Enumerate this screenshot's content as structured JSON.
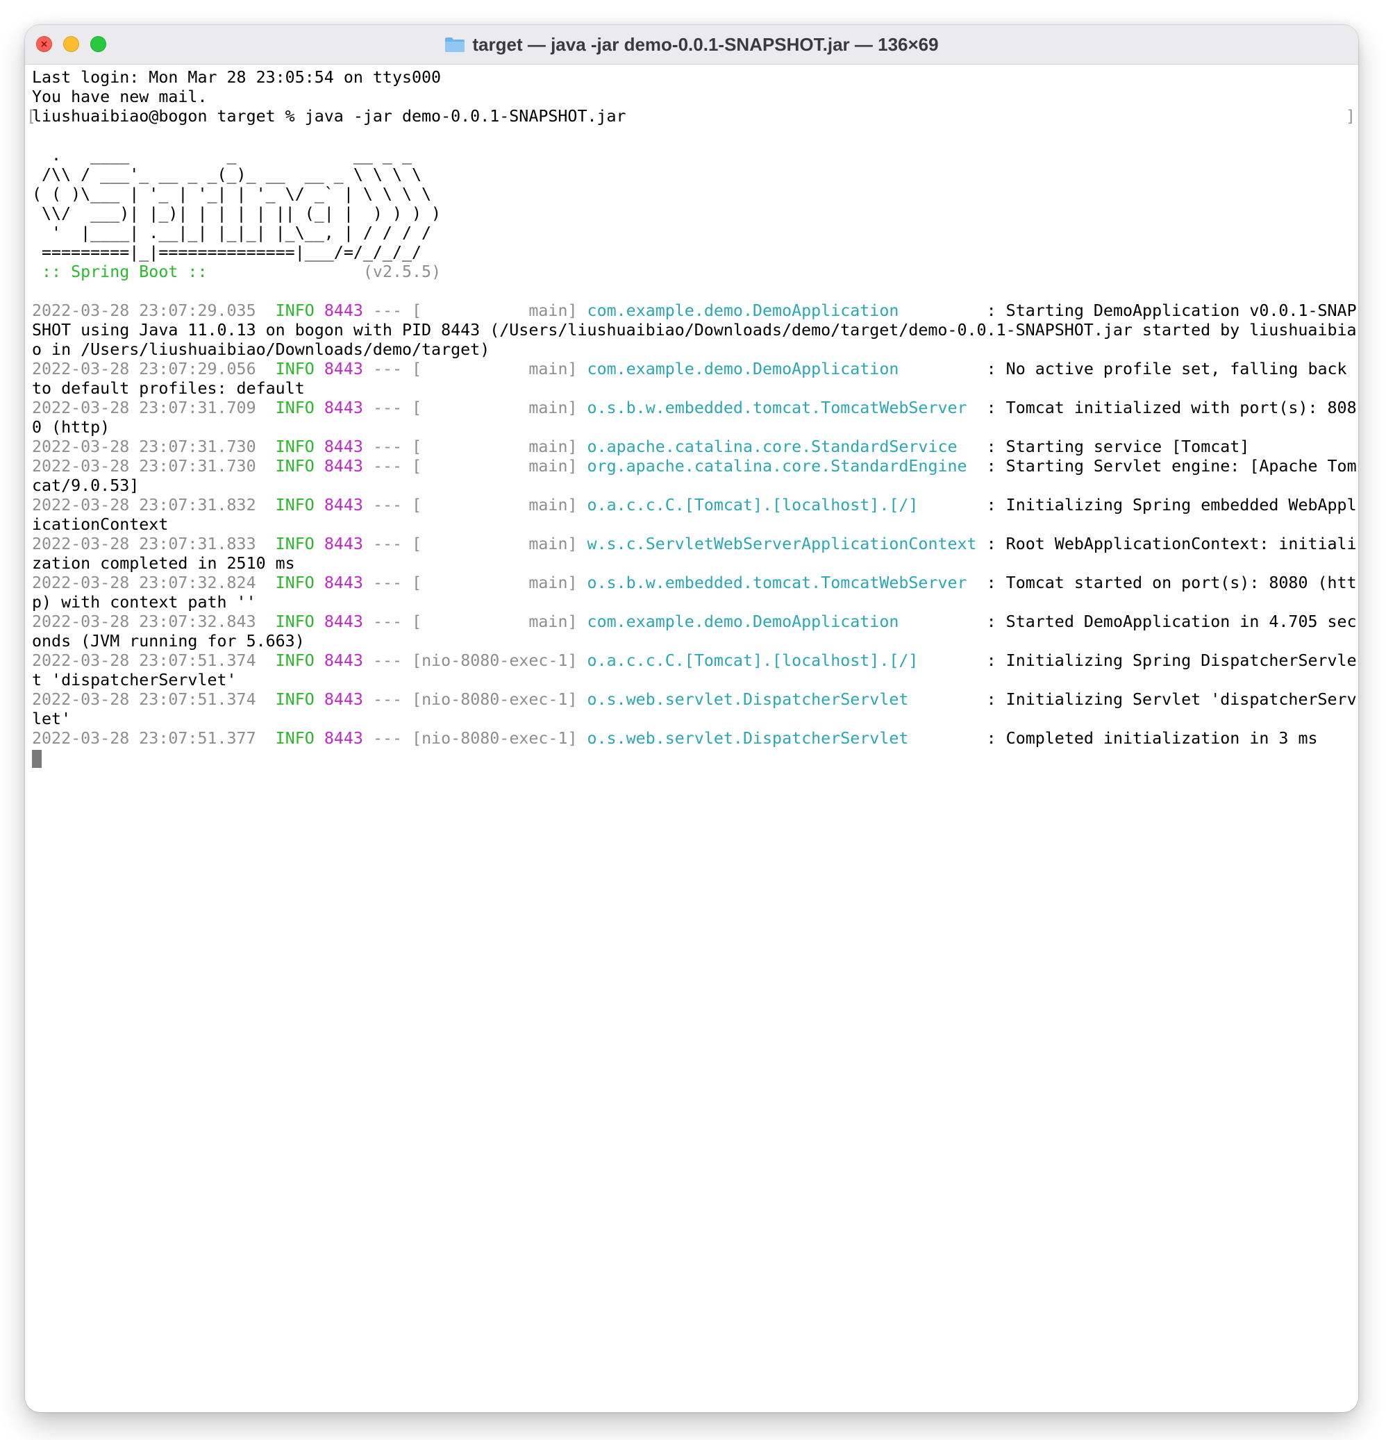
{
  "window": {
    "title": "target — java -jar demo-0.0.1-SNAPSHOT.jar — 136×69",
    "icon": "folder-icon"
  },
  "terminal": {
    "last_login": "Last login: Mon Mar 28 23:05:54 on ttys000",
    "mail": "You have new mail.",
    "prompt": "liushuaibiao@bogon target % java -jar demo-0.0.1-SNAPSHOT.jar",
    "banner": [
      "  .   ____          _            __ _ _",
      " /\\\\ / ___'_ __ _ _(_)_ __  __ _ \\ \\ \\ \\",
      "( ( )\\___ | '_ | '_| | '_ \\/ _` | \\ \\ \\ \\",
      " \\\\/  ___)| |_)| | | | | || (_| |  ) ) ) )",
      "  '  |____| .__|_| |_|_| |_\\__, | / / / /",
      " =========|_|==============|___/=/_/_/_/"
    ],
    "spring_boot_label": " :: Spring Boot :: ",
    "spring_boot_version": "               (v2.5.5)",
    "logs": [
      {
        "ts": "2022-03-28 23:07:29.035",
        "level": "INFO",
        "pid": "8443",
        "sep": "---",
        "thread": "[           main]",
        "logger": "com.example.demo.DemoApplication        ",
        "msg": ": Starting DemoApplication v0.0.1-SNAP",
        "cont": [
          "SHOT using Java 11.0.13 on bogon with PID 8443 (/Users/liushuaibiao/Downloads/demo/target/demo-0.0.1-SNAPSHOT.jar started by liushuaibia",
          "o in /Users/liushuaibiao/Downloads/demo/target)"
        ]
      },
      {
        "ts": "2022-03-28 23:07:29.056",
        "level": "INFO",
        "pid": "8443",
        "sep": "---",
        "thread": "[           main]",
        "logger": "com.example.demo.DemoApplication        ",
        "msg": ": No active profile set, falling back",
        "cont": [
          "to default profiles: default"
        ]
      },
      {
        "ts": "2022-03-28 23:07:31.709",
        "level": "INFO",
        "pid": "8443",
        "sep": "---",
        "thread": "[           main]",
        "logger": "o.s.b.w.embedded.tomcat.TomcatWebServer ",
        "msg": ": Tomcat initialized with port(s): 808",
        "cont": [
          "0 (http)"
        ]
      },
      {
        "ts": "2022-03-28 23:07:31.730",
        "level": "INFO",
        "pid": "8443",
        "sep": "---",
        "thread": "[           main]",
        "logger": "o.apache.catalina.core.StandardService  ",
        "msg": ": Starting service [Tomcat]",
        "cont": []
      },
      {
        "ts": "2022-03-28 23:07:31.730",
        "level": "INFO",
        "pid": "8443",
        "sep": "---",
        "thread": "[           main]",
        "logger": "org.apache.catalina.core.StandardEngine ",
        "msg": ": Starting Servlet engine: [Apache Tom",
        "cont": [
          "cat/9.0.53]"
        ]
      },
      {
        "ts": "2022-03-28 23:07:31.832",
        "level": "INFO",
        "pid": "8443",
        "sep": "---",
        "thread": "[           main]",
        "logger": "o.a.c.c.C.[Tomcat].[localhost].[/]      ",
        "msg": ": Initializing Spring embedded WebAppl",
        "cont": [
          "icationContext"
        ]
      },
      {
        "ts": "2022-03-28 23:07:31.833",
        "level": "INFO",
        "pid": "8443",
        "sep": "---",
        "thread": "[           main]",
        "logger": "w.s.c.ServletWebServerApplicationContext",
        "msg": ": Root WebApplicationContext: initiali",
        "cont": [
          "zation completed in 2510 ms"
        ]
      },
      {
        "ts": "2022-03-28 23:07:32.824",
        "level": "INFO",
        "pid": "8443",
        "sep": "---",
        "thread": "[           main]",
        "logger": "o.s.b.w.embedded.tomcat.TomcatWebServer ",
        "msg": ": Tomcat started on port(s): 8080 (htt",
        "cont": [
          "p) with context path ''"
        ]
      },
      {
        "ts": "2022-03-28 23:07:32.843",
        "level": "INFO",
        "pid": "8443",
        "sep": "---",
        "thread": "[           main]",
        "logger": "com.example.demo.DemoApplication        ",
        "msg": ": Started DemoApplication in 4.705 sec",
        "cont": [
          "onds (JVM running for 5.663)"
        ]
      },
      {
        "ts": "2022-03-28 23:07:51.374",
        "level": "INFO",
        "pid": "8443",
        "sep": "---",
        "thread": "[nio-8080-exec-1]",
        "logger": "o.a.c.c.C.[Tomcat].[localhost].[/]      ",
        "msg": ": Initializing Spring DispatcherServle",
        "cont": [
          "t 'dispatcherServlet'"
        ]
      },
      {
        "ts": "2022-03-28 23:07:51.374",
        "level": "INFO",
        "pid": "8443",
        "sep": "---",
        "thread": "[nio-8080-exec-1]",
        "logger": "o.s.web.servlet.DispatcherServlet       ",
        "msg": ": Initializing Servlet 'dispatcherServ",
        "cont": [
          "let'"
        ]
      },
      {
        "ts": "2022-03-28 23:07:51.377",
        "level": "INFO",
        "pid": "8443",
        "sep": "---",
        "thread": "[nio-8080-exec-1]",
        "logger": "o.s.web.servlet.DispatcherServlet       ",
        "msg": ": Completed initialization in 3 ms",
        "cont": []
      }
    ]
  }
}
